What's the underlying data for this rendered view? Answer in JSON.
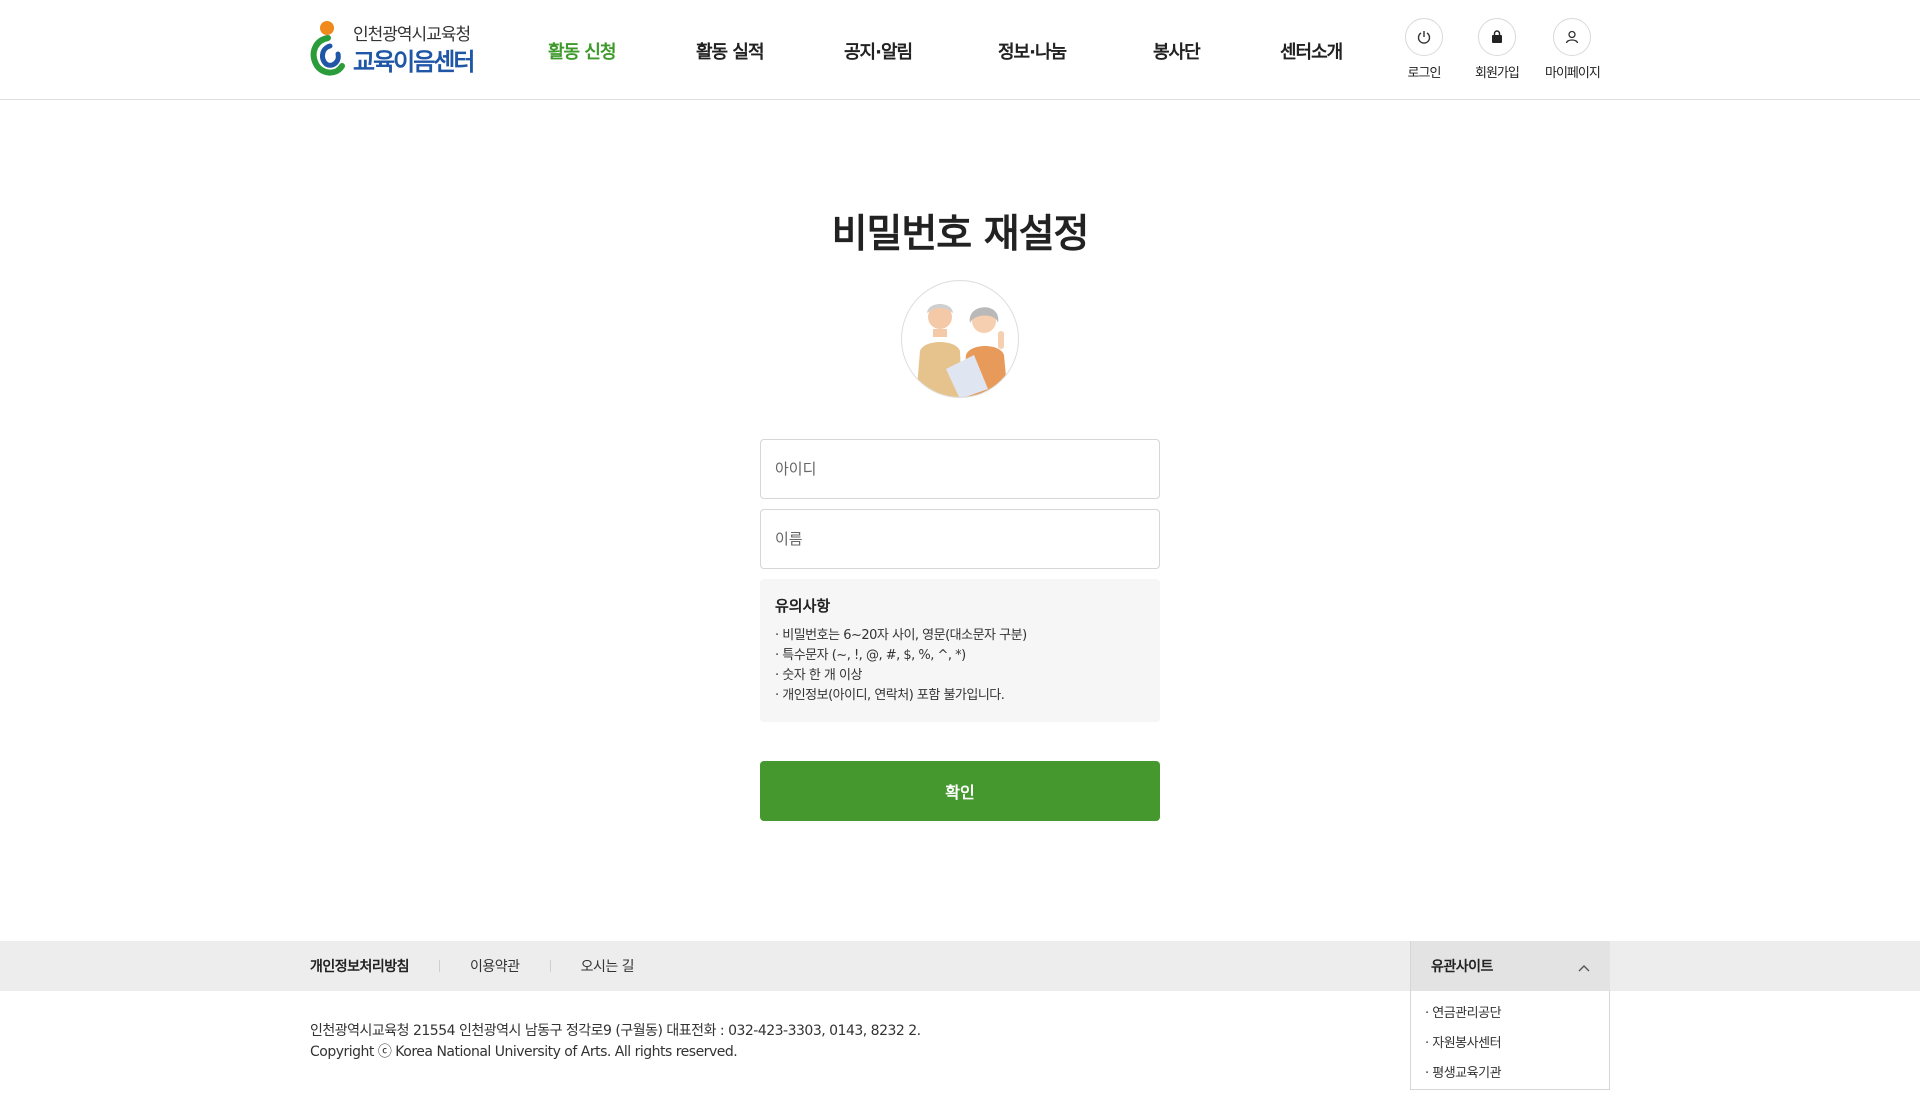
{
  "header": {
    "logo_top": "인천광역시교육청",
    "logo_main": "교육이음센터",
    "nav": [
      {
        "label": "활동 신청",
        "active": true
      },
      {
        "label": "활동 실적",
        "active": false
      },
      {
        "label": "공지·알림",
        "active": false
      },
      {
        "label": "정보·나눔",
        "active": false
      },
      {
        "label": "봉사단",
        "active": false
      },
      {
        "label": "센터소개",
        "active": false
      }
    ],
    "utility": [
      {
        "label": "로그인",
        "icon": "power-icon"
      },
      {
        "label": "회원가입",
        "icon": "bag-icon"
      },
      {
        "label": "마이페이지",
        "icon": "user-icon"
      }
    ]
  },
  "main": {
    "title": "비밀번호 재설정",
    "id_placeholder": "아이디",
    "name_placeholder": "이름",
    "notice": {
      "title": "유의사항",
      "lines": [
        "· 비밀번호는 6~20자 사이, 영문(대소문자 구분)",
        "· 특수문자 (~, !, @, #, $, %, ^, *)",
        "· 숫자 한 개 이상",
        "· 개인정보(아이디, 연락처) 포함 불가입니다."
      ]
    },
    "confirm_label": "확인"
  },
  "footer": {
    "links": [
      "개인정보처리방침",
      "이용약관",
      "오시는 길"
    ],
    "family_title": "유관사이트",
    "family_items": [
      "연금관리공단",
      "자원봉사센터",
      "평생교육기관"
    ],
    "address": "인천광역시교육청 21554 인천광역시 남동구 정각로9 (구월동) 대표전화 : 032-423-3303, 0143, 8232 2.",
    "copyright": "Copyright ⓒ Korea National University of Arts. All rights reserved."
  },
  "colors": {
    "accent_green": "#45982d",
    "nav_active": "#3f9a2c",
    "logo_blue": "#1f56a6"
  }
}
